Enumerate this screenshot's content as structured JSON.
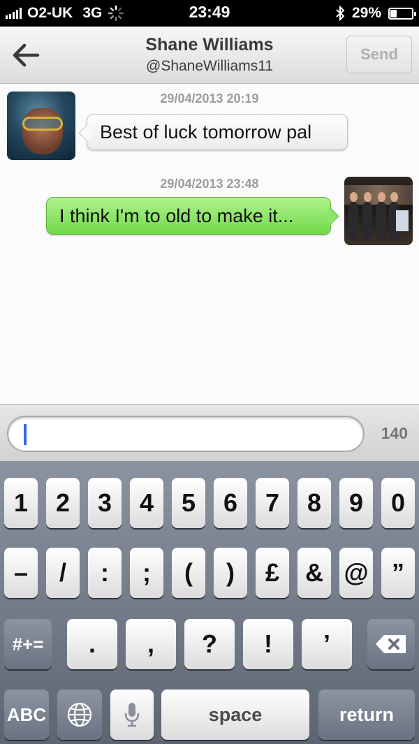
{
  "status_bar": {
    "carrier": "O2-UK",
    "network": "3G",
    "time": "23:49",
    "battery_percent": "29%",
    "battery_level": 0.29
  },
  "nav": {
    "contact_name": "Shane Williams",
    "contact_handle": "@ShaneWilliams11",
    "send_label": "Send",
    "back_icon": "back-arrow-icon"
  },
  "messages": [
    {
      "direction": "incoming",
      "timestamp": "29/04/2013 20:19",
      "text": "Best of luck tomorrow pal"
    },
    {
      "direction": "outgoing",
      "timestamp": "29/04/2013 23:48",
      "text": "I think I'm to old to make it..."
    }
  ],
  "composer": {
    "value": "",
    "char_count": "140"
  },
  "keyboard": {
    "row1": [
      "1",
      "2",
      "3",
      "4",
      "5",
      "6",
      "7",
      "8",
      "9",
      "0"
    ],
    "row2": [
      "–",
      "/",
      ":",
      ";",
      "(",
      ")",
      "£",
      "&",
      "@",
      "”"
    ],
    "row3_toggle": "#+=",
    "row3": [
      ".",
      ",",
      "?",
      "!",
      "’"
    ],
    "abc_label": "ABC",
    "space_label": "space",
    "return_label": "return"
  },
  "colors": {
    "outgoing_bubble": "#8fe56a",
    "incoming_bubble": "#f3f3f3",
    "caret": "#3a66e0"
  }
}
